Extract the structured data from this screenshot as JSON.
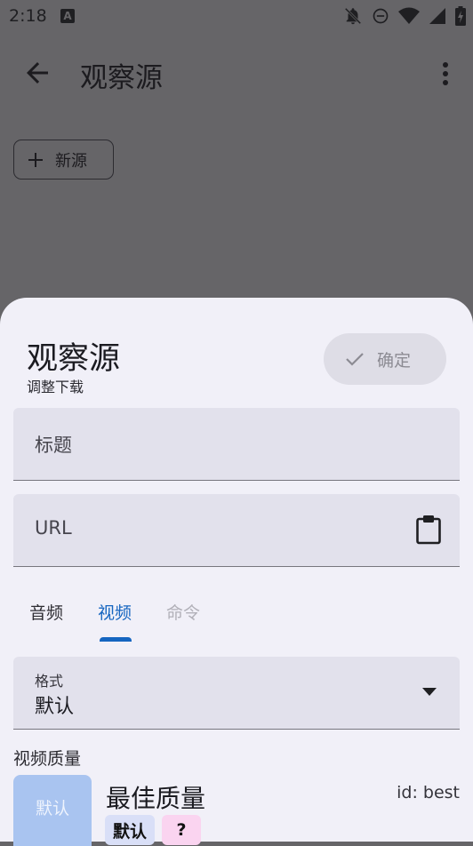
{
  "status_bar": {
    "time": "2:18",
    "notification_letter": "A",
    "icons": [
      "notifications-off-icon",
      "do-not-disturb-icon",
      "wifi-icon",
      "signal-icon",
      "battery-charging-icon"
    ]
  },
  "app_bar": {
    "title": "观察源",
    "new_source_label": "新源"
  },
  "sheet": {
    "title": "观察源",
    "subtitle": "调整下载",
    "confirm_label": "确定",
    "fields": {
      "title_placeholder": "标题",
      "url_placeholder": "URL"
    },
    "tabs": [
      {
        "label": "音频",
        "state": "normal"
      },
      {
        "label": "视频",
        "state": "selected"
      },
      {
        "label": "命令",
        "state": "disabled"
      }
    ],
    "format": {
      "label": "格式",
      "value": "默认"
    },
    "video_quality": {
      "section_label": "视频质量",
      "thumb_label": "默认",
      "name": "最佳质量",
      "id": "id: best",
      "badges": [
        "默认",
        "?"
      ]
    }
  },
  "colors": {
    "scrim": "#666568",
    "sheet_bg": "#f1f0f8",
    "field_bg": "#e2e1ec",
    "accent": "#1565c0",
    "thumb": "#a9c4f0"
  }
}
